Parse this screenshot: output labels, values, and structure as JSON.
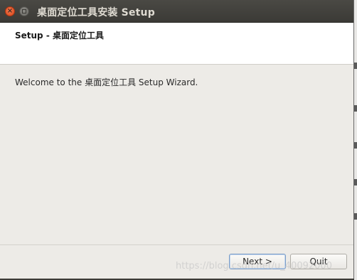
{
  "window": {
    "title": "桌面定位工具安装 Setup",
    "close_glyph": "×"
  },
  "header": {
    "title": "Setup - 桌面定位工具"
  },
  "content": {
    "welcome": "Welcome to the 桌面定位工具 Setup Wizard."
  },
  "buttons": {
    "next_label": "Next >",
    "quit_label": "Quit"
  },
  "watermark": {
    "text": "https://blog.csdn.net/u_40092000"
  },
  "colors": {
    "titlebar": "#3b3a36",
    "window_bg": "#edebe7",
    "header_bg": "#ffffff",
    "close_button": "#e95420",
    "default_button_border": "#7a9cc6"
  },
  "icons": [
    "close-icon",
    "minimize-icon"
  ]
}
